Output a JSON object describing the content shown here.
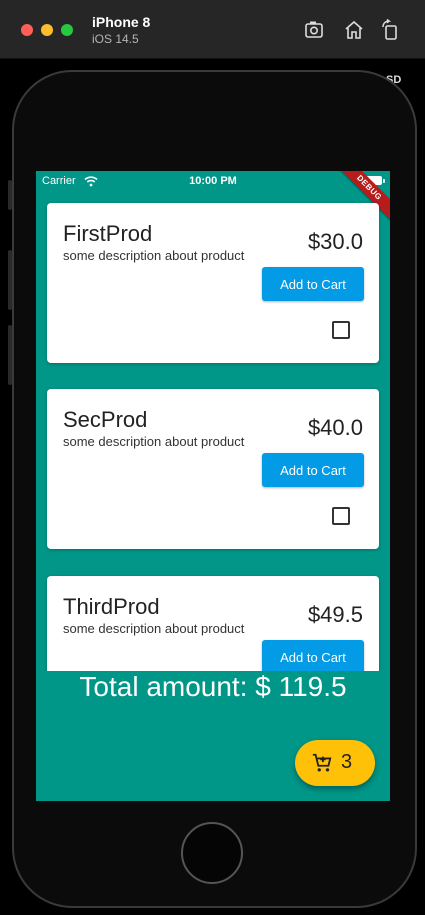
{
  "simulator": {
    "device_name": "iPhone 8",
    "os_version": "iOS 14.5",
    "partial_label": "SD",
    "icons": [
      "screenshot-icon",
      "home-icon",
      "rotate-icon"
    ]
  },
  "status_bar": {
    "carrier": "Carrier",
    "time": "10:00 PM"
  },
  "debug_banner": "DEBUG",
  "products": [
    {
      "name": "FirstProd",
      "description": "some description about product",
      "price": "$30.0",
      "button_label": "Add to Cart",
      "checked": false
    },
    {
      "name": "SecProd",
      "description": "some description about product",
      "price": "$40.0",
      "button_label": "Add to Cart",
      "checked": false
    },
    {
      "name": "ThirdProd",
      "description": "some description about product",
      "price": "$49.5",
      "button_label": "Add to Cart",
      "checked": false
    }
  ],
  "total_text": "Total amount: $ 119.5",
  "cart_fab": {
    "count": "3"
  },
  "colors": {
    "background": "#009688",
    "button": "#039be5",
    "fab": "#ffc107",
    "debug_banner": "#b71c1c"
  }
}
